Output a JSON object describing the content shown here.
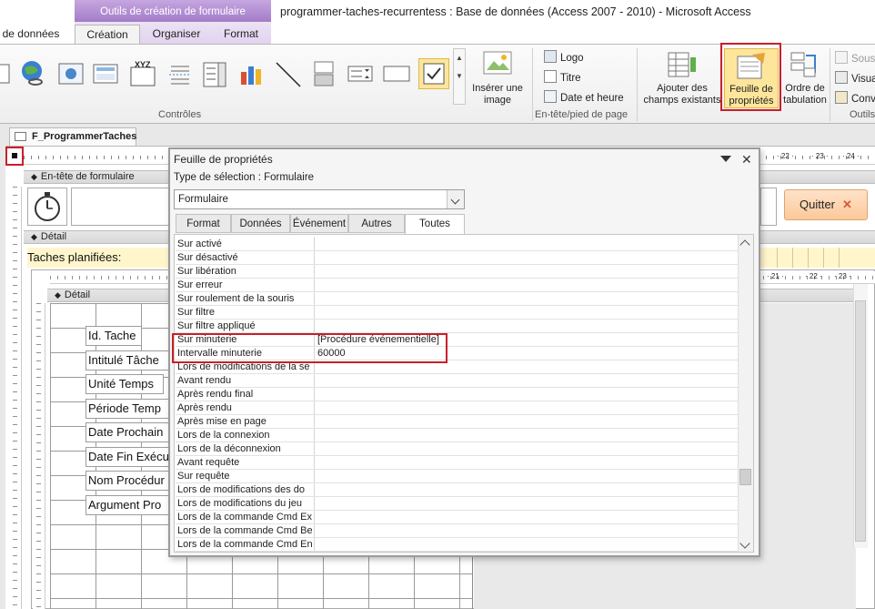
{
  "window": {
    "title": "programmer-taches-recurrentess : Base de données (Access 2007 - 2010)  -  Microsoft Access",
    "context_group": "Outils de création de formulaire"
  },
  "ribbon_tabs": [
    "de données",
    "Création",
    "Organiser",
    "Format"
  ],
  "ribbon": {
    "group_controls": "Contrôles",
    "group_header_footer": "En-tête/pied de page",
    "group_tools": "Outils",
    "insert_image": "Insérer une image",
    "logo": "Logo",
    "title": "Titre",
    "date_time": "Date et heure",
    "add_fields": "Ajouter des champs existants",
    "property_sheet": "Feuille de propriétés",
    "tab_order": "Ordre de tabulation",
    "sub": "Sous",
    "visual": "Visua",
    "conv": "Conv"
  },
  "document": {
    "tab_name": "F_ProgrammerTaches",
    "form_header": "En-tête de formulaire",
    "detail": "Détail",
    "sub_detail": "Détail",
    "taches_label": "Taches planifiées:",
    "quit_button": "Quitter",
    "field_labels": [
      "Id. Tache",
      "Intitulé Tâche",
      "Unité Temps",
      "Période Temp",
      "Date Prochain",
      "Date Fin Exécu",
      "Nom Procédur",
      "Argument Pro"
    ]
  },
  "property_sheet": {
    "title": "Feuille de propriétés",
    "selection_type": "Type de sélection :  Formulaire",
    "selected_object": "Formulaire",
    "tabs": [
      "Format",
      "Données",
      "Événement",
      "Autres",
      "Toutes"
    ],
    "active_tab": "Toutes",
    "rows": [
      {
        "name": "Sur activé",
        "value": ""
      },
      {
        "name": "Sur désactivé",
        "value": ""
      },
      {
        "name": "Sur libération",
        "value": ""
      },
      {
        "name": "Sur erreur",
        "value": ""
      },
      {
        "name": "Sur roulement de la souris",
        "value": ""
      },
      {
        "name": "Sur filtre",
        "value": ""
      },
      {
        "name": "Sur filtre appliqué",
        "value": ""
      },
      {
        "name": "Sur minuterie",
        "value": "[Procédure événementielle]"
      },
      {
        "name": "Intervalle minuterie",
        "value": "60000"
      },
      {
        "name": "Lors de modifications de la se",
        "value": ""
      },
      {
        "name": "Avant rendu",
        "value": ""
      },
      {
        "name": "Après rendu final",
        "value": ""
      },
      {
        "name": "Après rendu",
        "value": ""
      },
      {
        "name": "Après mise en page",
        "value": ""
      },
      {
        "name": "Lors de la connexion",
        "value": ""
      },
      {
        "name": "Lors de la déconnexion",
        "value": ""
      },
      {
        "name": "Avant requête",
        "value": ""
      },
      {
        "name": "Sur requête",
        "value": ""
      },
      {
        "name": "Lors de modifications des do",
        "value": ""
      },
      {
        "name": "Lors de modifications du jeu",
        "value": ""
      },
      {
        "name": "Lors de la commande Cmd Ex",
        "value": ""
      },
      {
        "name": "Lors de la commande Cmd Be",
        "value": ""
      },
      {
        "name": "Lors de la commande Cmd En",
        "value": ""
      }
    ]
  },
  "colors": {
    "highlight": "#c8202a",
    "context_tab": "#a37cc8",
    "selected_button": "#fde69c",
    "header_stripe": "#fff6cc"
  }
}
